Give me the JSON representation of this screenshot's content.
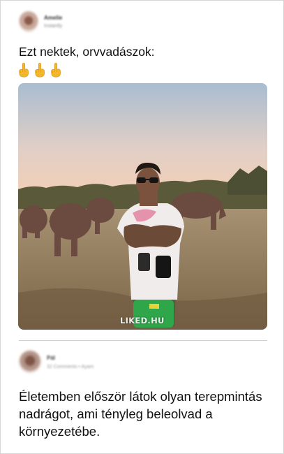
{
  "post": {
    "author_name": "Amelie",
    "author_meta": "Instantly",
    "text": "Ezt nektek, orvvadászok:",
    "emoji_icons": [
      "middle-finger-emoji",
      "middle-finger-emoji",
      "middle-finger-emoji"
    ],
    "watermark": "LIKED.HU"
  },
  "comment": {
    "author_name": "Pál",
    "author_meta": "32 Comments • Ayam",
    "text": "Életemben először látok olyan terepmintás nadrágot, ami tényleg beleolvad a környezetébe."
  },
  "colors": {
    "sky_top": "#a9bdd0",
    "sky_bottom": "#f1cfb6",
    "ground": "#8c7a5e",
    "emoji_yellow": "#f5b72a",
    "border": "#d6d6d6"
  }
}
